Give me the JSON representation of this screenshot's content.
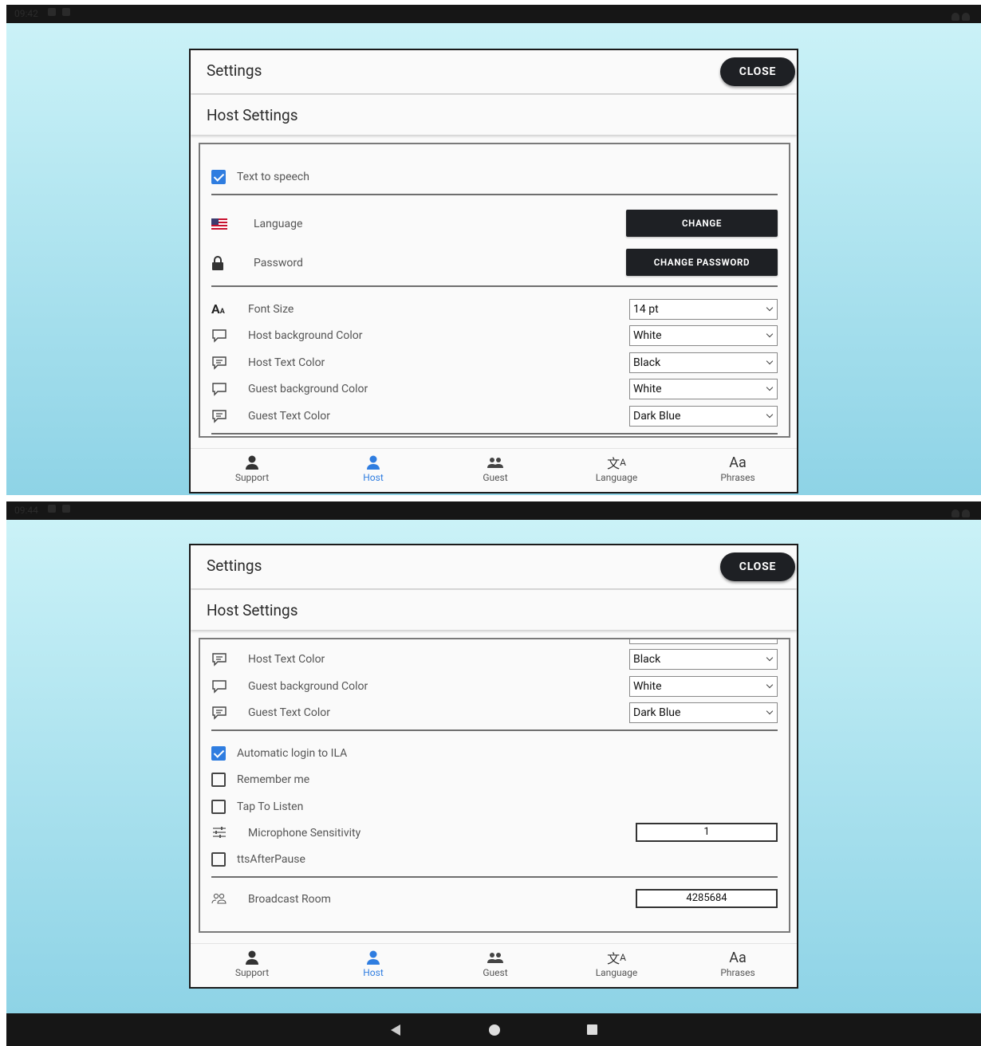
{
  "status": {
    "time1": "09:42",
    "time2": "09:44"
  },
  "header": {
    "title": "Settings",
    "close_label": "CLOSE"
  },
  "subheader": {
    "title": "Host Settings"
  },
  "screen1": {
    "tts_label": "Text to speech",
    "language_label": "Language",
    "change_label": "CHANGE",
    "password_label": "Password",
    "change_password_label": "CHANGE PASSWORD",
    "font_size_label": "Font Size",
    "font_size_value": "14 pt",
    "host_bg_label": "Host background Color",
    "host_bg_value": "White",
    "host_text_label": "Host Text Color",
    "host_text_value": "Black",
    "guest_bg_label": "Guest background Color",
    "guest_bg_value": "White",
    "guest_text_label": "Guest Text Color",
    "guest_text_value": "Dark Blue"
  },
  "screen2": {
    "host_text_label": "Host Text Color",
    "host_text_value": "Black",
    "guest_bg_label": "Guest background Color",
    "guest_bg_value": "White",
    "guest_text_label": "Guest Text Color",
    "guest_text_value": "Dark Blue",
    "auto_login_label": "Automatic login to ILA",
    "remember_label": "Remember me",
    "tap_listen_label": "Tap To Listen",
    "mic_label": "Microphone Sensitivity",
    "mic_value": "1",
    "tts_after_pause_label": "ttsAfterPause",
    "broadcast_label": "Broadcast Room",
    "broadcast_value": "4285684"
  },
  "tabs": [
    {
      "label": "Support",
      "icon": "person-icon"
    },
    {
      "label": "Host",
      "icon": "person-icon",
      "active": true
    },
    {
      "label": "Guest",
      "icon": "group-icon"
    },
    {
      "label": "Language",
      "icon": "translate-icon"
    },
    {
      "label": "Phrases",
      "icon": "text-aa-icon"
    }
  ],
  "colors": {
    "accent": "#2f7de0",
    "dark_button": "#1e2024"
  }
}
